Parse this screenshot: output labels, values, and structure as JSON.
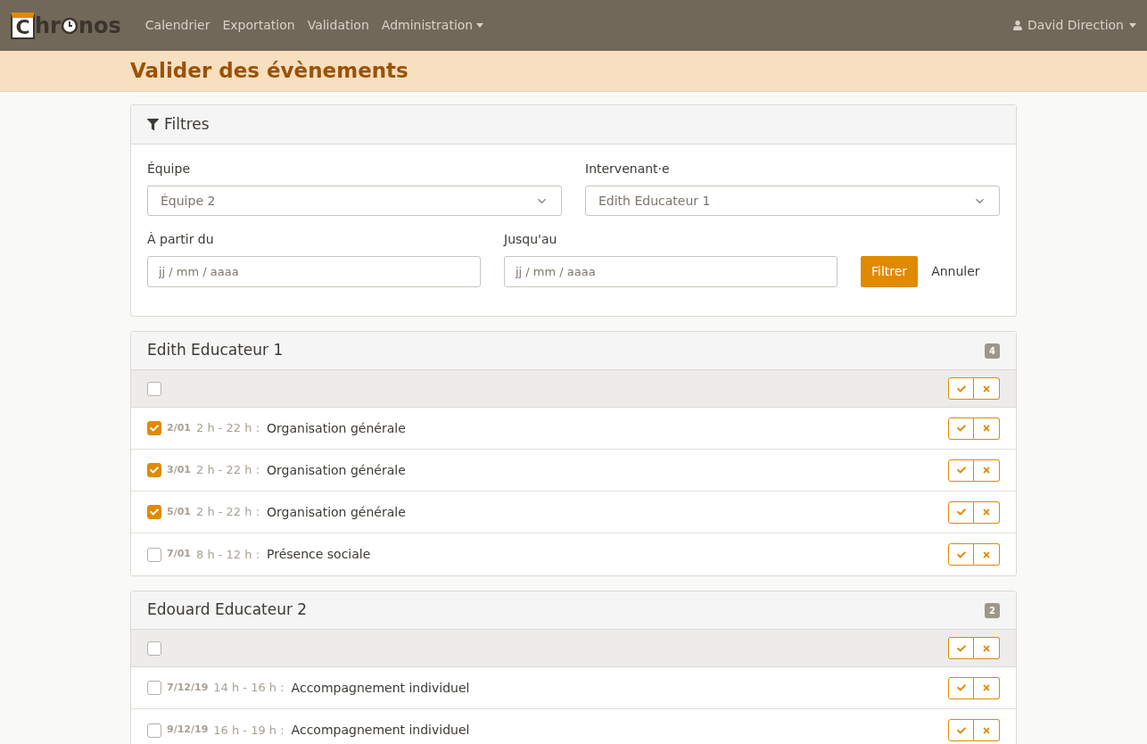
{
  "navbar": {
    "logo": {
      "first": "C",
      "middle": "hr",
      "last": "nos"
    },
    "links": [
      {
        "label": "Calendrier",
        "dropdown": false
      },
      {
        "label": "Exportation",
        "dropdown": false
      },
      {
        "label": "Validation",
        "dropdown": false
      },
      {
        "label": "Administration",
        "dropdown": true
      }
    ],
    "user": "David Direction"
  },
  "page_title": "Valider des évènements",
  "filters": {
    "title": "Filtres",
    "selects": [
      {
        "label": "Équipe",
        "value": "Équipe 2"
      },
      {
        "label": "Intervenant·e",
        "value": "Edith Educateur 1"
      }
    ],
    "dates": [
      {
        "label": "À partir du",
        "placeholder": "jj / mm / aaaa"
      },
      {
        "label": "Jusqu'au",
        "placeholder": "jj / mm / aaaa"
      }
    ],
    "submit": "Filtrer",
    "cancel": "Annuler"
  },
  "groups": [
    {
      "name": "Edith Educateur 1",
      "count": "4",
      "all_checked": false,
      "events": [
        {
          "checked": true,
          "date": "2/01",
          "time": "2 h - 22 h :",
          "title": "Organisation générale"
        },
        {
          "checked": true,
          "date": "3/01",
          "time": "2 h - 22 h :",
          "title": "Organisation générale"
        },
        {
          "checked": true,
          "date": "5/01",
          "time": "2 h - 22 h :",
          "title": "Organisation générale"
        },
        {
          "checked": false,
          "date": "7/01",
          "time": "8 h - 12 h :",
          "title": "Présence sociale"
        }
      ]
    },
    {
      "name": "Edouard Educateur 2",
      "count": "2",
      "all_checked": false,
      "events": [
        {
          "checked": false,
          "date": "7/12/19",
          "time": "14 h - 16 h :",
          "title": "Accompagnement individuel"
        },
        {
          "checked": false,
          "date": "9/12/19",
          "time": "16 h - 19 h :",
          "title": "Accompagnement individuel"
        }
      ]
    }
  ]
}
